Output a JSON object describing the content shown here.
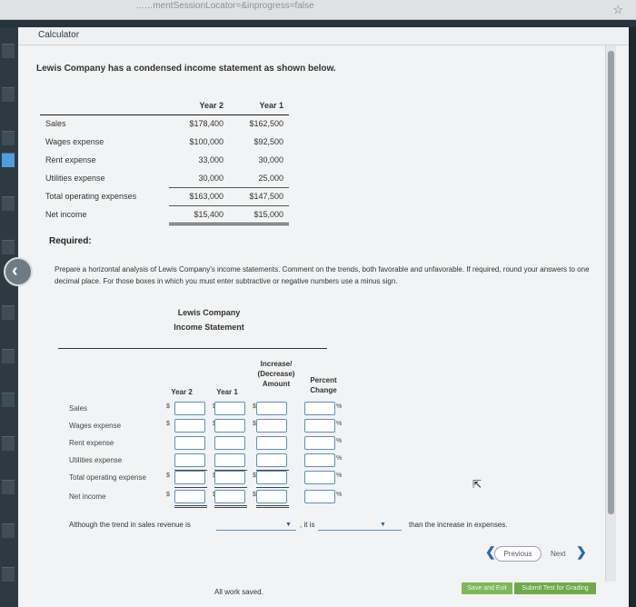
{
  "browser": {
    "url_fragment": "...…mentSessionLocator=&inprogress=false",
    "star_icon": "star-icon"
  },
  "calculator_label": "Calculator",
  "problem": {
    "intro": "Lewis Company has a condensed income statement as shown below.",
    "columns": [
      "Year 2",
      "Year 1"
    ],
    "rows": [
      {
        "label": "Sales",
        "y2": "$178,400",
        "y1": "$162,500"
      },
      {
        "label": "Wages expense",
        "y2": "$100,000",
        "y1": "$92,500"
      },
      {
        "label": "Rent expense",
        "y2": "33,000",
        "y1": "30,000"
      },
      {
        "label": "Utilities expense",
        "y2": "30,000",
        "y1": "25,000"
      },
      {
        "label": "Total operating expenses",
        "y2": "$163,000",
        "y1": "$147,500"
      },
      {
        "label": "Net income",
        "y2": "$15,400",
        "y1": "$15,000"
      }
    ]
  },
  "required_label": "Required:",
  "instructions": "Prepare a horizontal analysis of Lewis Company's income statements. Comment on the trends, both favorable and unfavorable. If required, round your answers to one decimal place. For those boxes in which you must enter subtractive or negative numbers use a minus sign.",
  "answer": {
    "company": "Lewis Company",
    "statement": "Income Statement",
    "col_year2": "Year 2",
    "col_year1": "Year 1",
    "col_increase": [
      "Increase/",
      "(Decrease)",
      "Amount"
    ],
    "col_percent": [
      "Percent",
      "Change"
    ],
    "dollar_sign": "$",
    "percent_sign": "%",
    "rows": [
      "Sales",
      "Wages expense",
      "Rent expense",
      "Utilities expense",
      "Total operating expense",
      "Net income"
    ],
    "sentence_start": "Although the trend in sales revenue is",
    "sentence_mid": ", it is",
    "sentence_end": "than the increase in expenses."
  },
  "nav": {
    "previous": "Previous",
    "next": "Next"
  },
  "footer": {
    "status": "All work saved.",
    "save_exit": "Save and Exit",
    "submit": "Submit Test for Grading"
  }
}
